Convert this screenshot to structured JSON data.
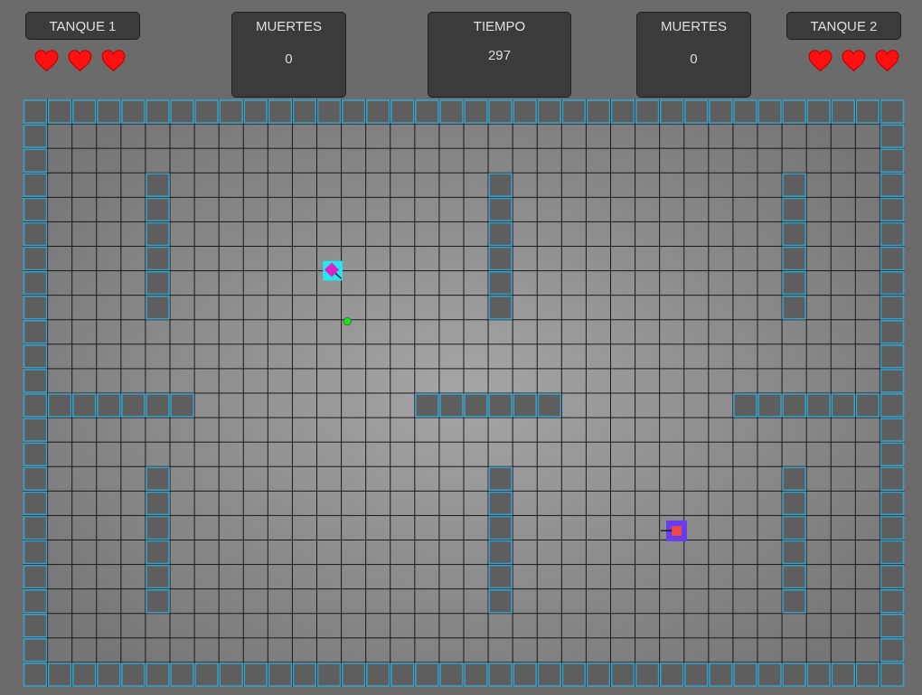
{
  "players": [
    {
      "label": "TANQUE 1",
      "stars": 3
    },
    {
      "label": "TANQUE 2",
      "stars": 3
    }
  ],
  "stats": [
    {
      "label": "MUERTES",
      "value": "0"
    },
    {
      "label": "TIEMPO",
      "value": "297"
    },
    {
      "label": "MUERTES",
      "value": "0"
    }
  ]
}
